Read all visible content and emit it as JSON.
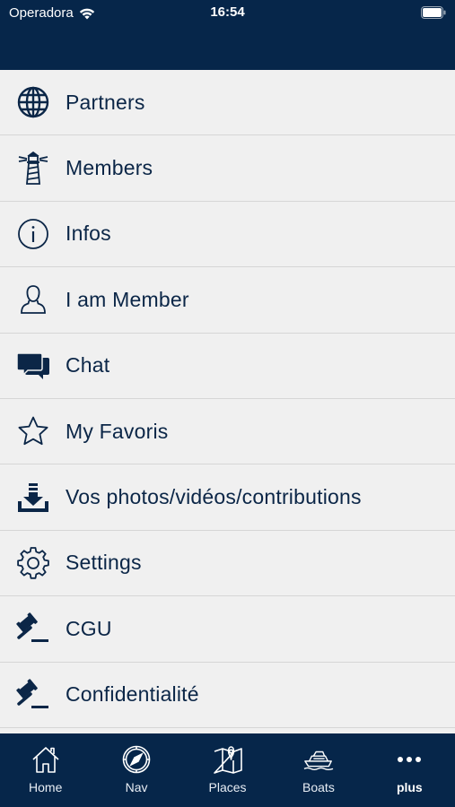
{
  "status_bar": {
    "carrier": "Operadora",
    "time": "16:54"
  },
  "menu": {
    "items": [
      {
        "label": "Partners",
        "icon": "globe-icon"
      },
      {
        "label": "Members",
        "icon": "lighthouse-icon"
      },
      {
        "label": "Infos",
        "icon": "info-icon"
      },
      {
        "label": "I am Member",
        "icon": "user-icon"
      },
      {
        "label": "Chat",
        "icon": "chat-icon"
      },
      {
        "label": "My Favoris",
        "icon": "star-icon"
      },
      {
        "label": "Vos photos/vidéos/contributions",
        "icon": "download-icon"
      },
      {
        "label": "Settings",
        "icon": "gear-icon"
      },
      {
        "label": "CGU",
        "icon": "gavel-icon"
      },
      {
        "label": "Confidentialité",
        "icon": "gavel-icon"
      }
    ]
  },
  "tab_bar": {
    "tabs": [
      {
        "label": "Home",
        "icon": "home-icon"
      },
      {
        "label": "Nav",
        "icon": "compass-icon"
      },
      {
        "label": "Places",
        "icon": "map-icon"
      },
      {
        "label": "Boats",
        "icon": "boat-icon"
      },
      {
        "label": "plus",
        "icon": "more-icon",
        "active": true
      }
    ]
  },
  "colors": {
    "navy": "#06264a",
    "text": "#0b2647",
    "background": "#f0f0f0",
    "divider": "#d6d6d6"
  }
}
